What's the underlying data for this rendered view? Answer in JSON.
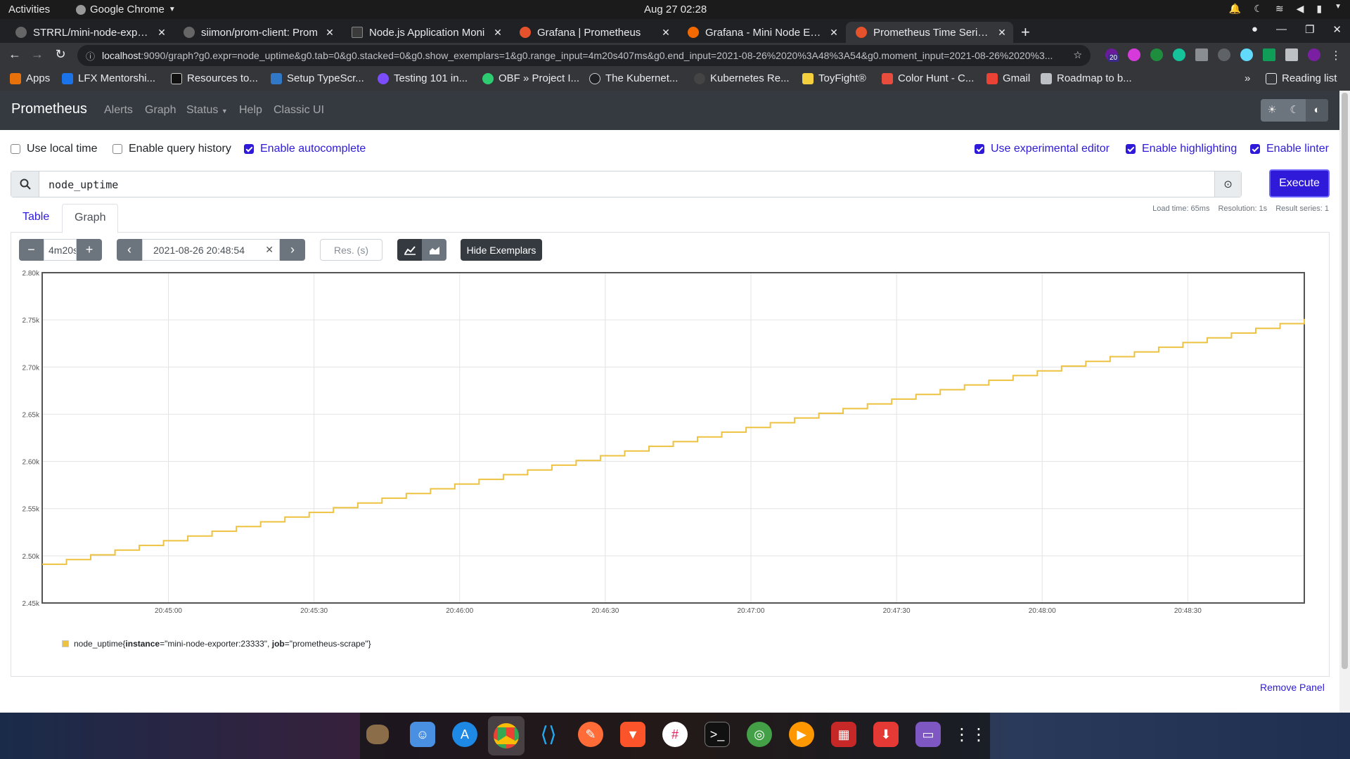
{
  "system_bar": {
    "activities": "Activities",
    "app_name": "Google Chrome",
    "clock": "Aug 27  02:28"
  },
  "browser": {
    "tabs": [
      {
        "title": "STRRL/mini-node-exporte",
        "active": false
      },
      {
        "title": "siimon/prom-client: Prom",
        "active": false
      },
      {
        "title": "Node.js Application Moni",
        "active": false
      },
      {
        "title": "Grafana | Prometheus",
        "active": false
      },
      {
        "title": "Grafana - Mini Node Expo",
        "active": false
      },
      {
        "title": "Prometheus Time Series C",
        "active": true
      }
    ],
    "url_host": "localhost",
    "url_rest": ":9090/graph?g0.expr=node_uptime&g0.tab=0&g0.stacked=0&g0.show_exemplars=1&g0.range_input=4m20s407ms&g0.end_input=2021-08-26%2020%3A48%3A54&g0.moment_input=2021-08-26%2020%3...",
    "extension_badge": "20",
    "bookmarks": [
      "Apps",
      "LFX Mentorshi...",
      "Resources to...",
      "Setup TypeScr...",
      "Testing 101 in...",
      "OBF » Project I...",
      "The Kubernet...",
      "Kubernetes Re...",
      "ToyFight®",
      "Color Hunt - C...",
      "Gmail",
      "Roadmap to b..."
    ],
    "bookmarks_overflow": "»",
    "reading_list": "Reading list"
  },
  "prometheus": {
    "brand": "Prometheus",
    "nav": {
      "alerts": "Alerts",
      "graph": "Graph",
      "status": "Status",
      "help": "Help",
      "classic_ui": "Classic UI"
    },
    "options": {
      "use_local_time": {
        "label": "Use local time",
        "checked": false
      },
      "enable_query_history": {
        "label": "Enable query history",
        "checked": false
      },
      "enable_autocomplete": {
        "label": "Enable autocomplete",
        "checked": true
      },
      "use_experimental_editor": {
        "label": "Use experimental editor",
        "checked": true
      },
      "enable_highlighting": {
        "label": "Enable highlighting",
        "checked": true
      },
      "enable_linter": {
        "label": "Enable linter",
        "checked": true
      }
    },
    "query": "node_uptime",
    "execute_label": "Execute",
    "tabs": {
      "table": "Table",
      "graph": "Graph"
    },
    "stats": {
      "load_time": "Load time: 65ms",
      "resolution": "Resolution: 1s",
      "result_series": "Result series: 1"
    },
    "controls": {
      "range": "4m20s",
      "end_time": "2021-08-26 20:48:54",
      "resolution_placeholder": "Res. (s)",
      "hide_exemplars": "Hide Exemplars"
    },
    "remove_panel": "Remove Panel"
  },
  "chart_data": {
    "type": "line",
    "title": "",
    "xlabel": "",
    "ylabel": "",
    "x_ticks": [
      "20:45:00",
      "20:45:30",
      "20:46:00",
      "20:46:30",
      "20:47:00",
      "20:47:30",
      "20:48:00",
      "20:48:30"
    ],
    "y_ticks": [
      "2.45k",
      "2.50k",
      "2.55k",
      "2.60k",
      "2.65k",
      "2.70k",
      "2.75k",
      "2.80k"
    ],
    "ylim": [
      2450,
      2800
    ],
    "xlim": [
      "20:44:34",
      "20:48:54"
    ],
    "grid": true,
    "legend": "bottom-left",
    "series": [
      {
        "name": "node_uptime{instance=\"mini-node-exporter:23333\", job=\"prometheus-scrape\"}",
        "metric": "node_uptime",
        "labels": [
          {
            "key": "instance",
            "value": "mini-node-exporter:23333"
          },
          {
            "key": "job",
            "value": "prometheus-scrape"
          }
        ],
        "color": "#edc240",
        "step_seconds": 5,
        "x": [
          "20:44:34",
          "20:48:54"
        ],
        "y": [
          2491,
          2751
        ]
      }
    ]
  }
}
